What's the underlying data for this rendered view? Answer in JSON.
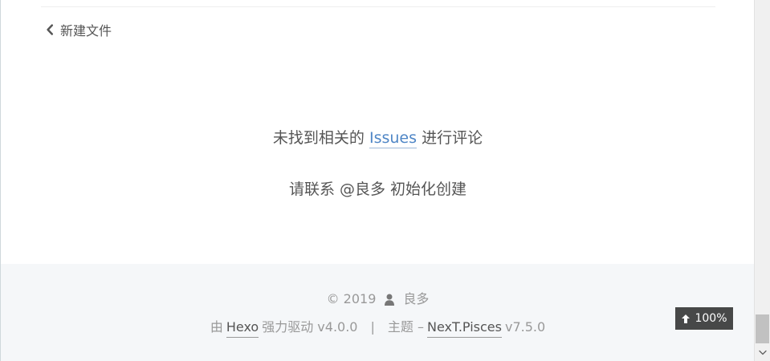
{
  "navigation": {
    "previous_post": "新建文件",
    "previous_icon": "chevron-left-icon"
  },
  "comments": {
    "line1_before": "未找到相关的",
    "issues_link": "Issues",
    "line1_after": "进行评论",
    "line2": "请联系 @良多 初始化创建"
  },
  "footer": {
    "copyright": "© 2019",
    "author_icon": "user-icon",
    "author": "良多",
    "powered_prefix": "由",
    "hexo_link": "Hexo",
    "powered_suffix": "强力驱动 v4.0.0",
    "separator": "|",
    "theme_prefix": "主题 –",
    "theme_link": "NexT.Pisces",
    "theme_version": "v7.5.0"
  },
  "back_to_top": {
    "icon": "arrow-up-icon",
    "label": "100%"
  },
  "colors": {
    "link": "#4f86c6",
    "footer_background": "#f5f7f9",
    "back_to_top_background": "#222222"
  }
}
